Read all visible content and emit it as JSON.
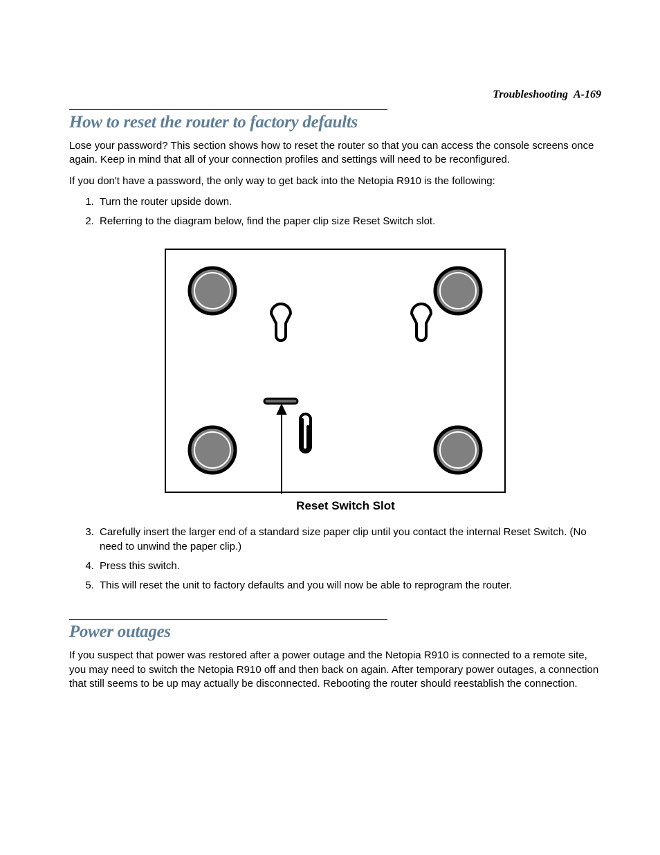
{
  "header": {
    "section": "Troubleshooting",
    "page": "A-169"
  },
  "section1": {
    "heading": "How to reset the router to factory defaults",
    "para1": "Lose your password? This section shows how to reset the router so that you can access the console screens once again. Keep in mind that all of your connection profiles and settings will need to be reconfigured.",
    "para2": "If you don't have a password, the only way to get back into the Netopia R910 is the following:",
    "step1": "Turn the router upside down.",
    "step2": "Referring to the diagram below, find the paper clip size Reset Switch slot.",
    "diagram_caption": "Reset Switch Slot",
    "step3": "Carefully insert the larger end of a standard size paper clip until you contact the internal Reset Switch. (No need to unwind the paper clip.)",
    "step4": "Press this switch.",
    "step5": "This will reset the unit to factory defaults and you will now be able to reprogram the router."
  },
  "section2": {
    "heading": "Power outages",
    "para1": "If you suspect that power was restored after a power outage and the Netopia R910 is connected to a remote site, you may need to switch the Netopia R910 off and then back on again. After temporary power outages, a connection that still seems to be up may actually be disconnected. Rebooting the router should reestablish the connection."
  }
}
